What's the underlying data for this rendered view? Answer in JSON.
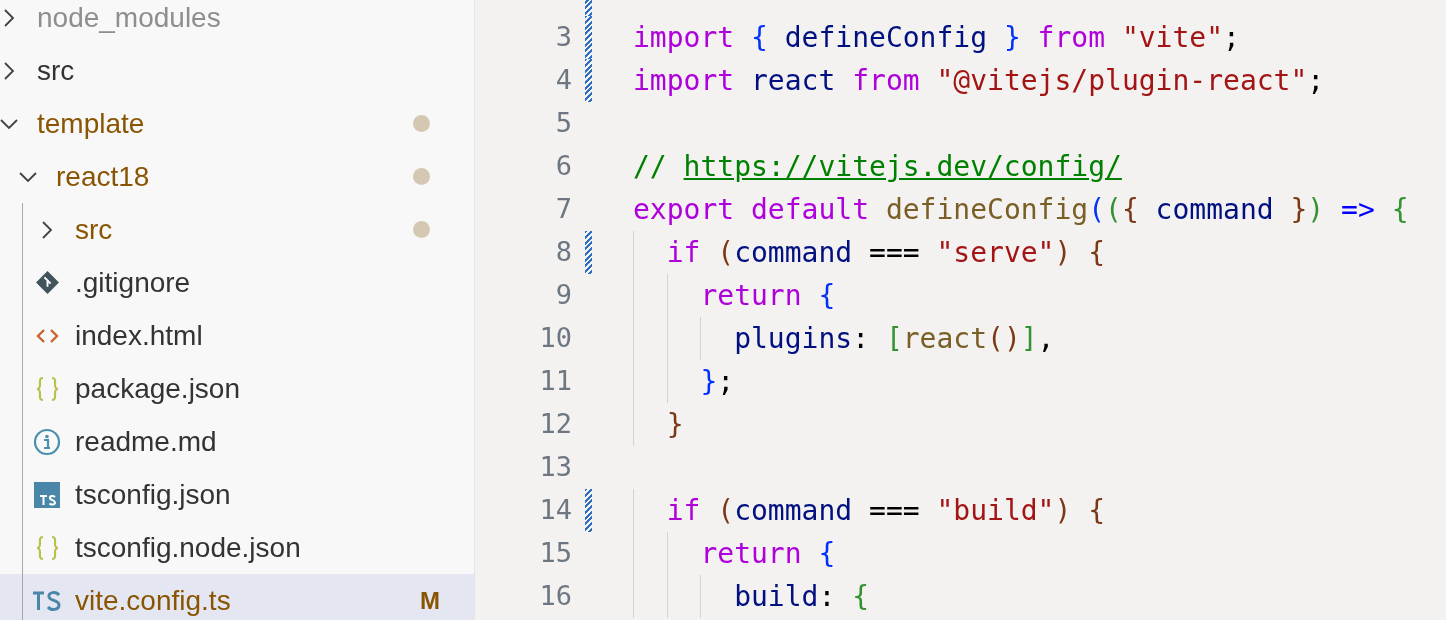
{
  "explorer": {
    "items": [
      {
        "name": "node_modules",
        "kind": "folder",
        "expanded": false,
        "ignored": true,
        "modified": false,
        "selected": false
      },
      {
        "name": "src",
        "kind": "folder",
        "expanded": false,
        "ignored": false,
        "modified": false,
        "selected": false
      },
      {
        "name": "template",
        "kind": "folder",
        "expanded": true,
        "ignored": false,
        "modified": true,
        "selected": false,
        "children": [
          {
            "name": "react18",
            "kind": "folder",
            "expanded": true,
            "ignored": false,
            "modified": true,
            "selected": false,
            "children": [
              {
                "name": "src",
                "kind": "folder",
                "expanded": false,
                "ignored": false,
                "modified": true,
                "selected": false
              },
              {
                "name": ".gitignore",
                "kind": "git",
                "ignored": false,
                "modified": false,
                "selected": false
              },
              {
                "name": "index.html",
                "kind": "html",
                "ignored": false,
                "modified": false,
                "selected": false
              },
              {
                "name": "package.json",
                "kind": "json",
                "ignored": false,
                "modified": false,
                "selected": false
              },
              {
                "name": "readme.md",
                "kind": "info",
                "ignored": false,
                "modified": false,
                "selected": false
              },
              {
                "name": "tsconfig.json",
                "kind": "tsbox",
                "ignored": false,
                "modified": false,
                "selected": false
              },
              {
                "name": "tsconfig.node.json",
                "kind": "json",
                "ignored": false,
                "modified": false,
                "selected": false
              },
              {
                "name": "vite.config.ts",
                "kind": "ts",
                "ignored": false,
                "modified": true,
                "selected": true,
                "badge": "M"
              }
            ]
          }
        ]
      }
    ]
  },
  "editor": {
    "lines": [
      {
        "modified": true
      },
      {
        "number": "3",
        "modified": true,
        "tokens": [
          {
            "kind": "kw",
            "text": "import "
          },
          {
            "kind": "b1",
            "text": "{"
          },
          {
            "kind": "var",
            "text": " defineConfig "
          },
          {
            "kind": "b1",
            "text": "}"
          },
          {
            "kind": "kw",
            "text": " from "
          },
          {
            "kind": "str",
            "text": "\"vite\""
          },
          {
            "kind": "punct",
            "text": ";"
          }
        ]
      },
      {
        "number": "4",
        "modified": true,
        "tokens": [
          {
            "kind": "kw",
            "text": "import "
          },
          {
            "kind": "var",
            "text": "react "
          },
          {
            "kind": "kw",
            "text": "from "
          },
          {
            "kind": "str",
            "text": "\"@vitejs/plugin-react\""
          },
          {
            "kind": "punct",
            "text": ";"
          }
        ]
      },
      {
        "number": "5",
        "modified": false
      },
      {
        "number": "6",
        "modified": false,
        "tokens": [
          {
            "kind": "comment",
            "text": "// "
          },
          {
            "kind": "link",
            "text": "https://vitejs.dev/config/"
          }
        ]
      },
      {
        "number": "7",
        "modified": false,
        "tokens": [
          {
            "kind": "kw",
            "text": "export default "
          },
          {
            "kind": "fn",
            "text": "defineConfig"
          },
          {
            "kind": "b1",
            "text": "("
          },
          {
            "kind": "b2",
            "text": "("
          },
          {
            "kind": "b3",
            "text": "{"
          },
          {
            "kind": "var",
            "text": " command "
          },
          {
            "kind": "b3",
            "text": "}"
          },
          {
            "kind": "b2",
            "text": ")"
          },
          {
            "kind": "arrow",
            "text": " => "
          },
          {
            "kind": "b2",
            "text": "{"
          }
        ]
      },
      {
        "number": "8",
        "modified": true,
        "tokens": [
          {
            "kind": "kw",
            "text": "  if "
          },
          {
            "kind": "b3",
            "text": "("
          },
          {
            "kind": "var",
            "text": "command"
          },
          {
            "kind": "punct",
            "text": " === "
          },
          {
            "kind": "str",
            "text": "\"serve\""
          },
          {
            "kind": "b3",
            "text": ") {"
          }
        ]
      },
      {
        "number": "9",
        "modified": false,
        "tokens": [
          {
            "kind": "kw",
            "text": "    return "
          },
          {
            "kind": "b1",
            "text": "{"
          }
        ]
      },
      {
        "number": "10",
        "modified": false,
        "tokens": [
          {
            "kind": "var",
            "text": "      plugins"
          },
          {
            "kind": "punct",
            "text": ": "
          },
          {
            "kind": "b2",
            "text": "["
          },
          {
            "kind": "fn",
            "text": "react"
          },
          {
            "kind": "b3",
            "text": "()"
          },
          {
            "kind": "b2",
            "text": "]"
          },
          {
            "kind": "punct",
            "text": ","
          }
        ]
      },
      {
        "number": "11",
        "modified": false,
        "tokens": [
          {
            "kind": "b1",
            "text": "    }"
          },
          {
            "kind": "punct",
            "text": ";"
          }
        ]
      },
      {
        "number": "12",
        "modified": false,
        "tokens": [
          {
            "kind": "b3",
            "text": "  }"
          }
        ]
      },
      {
        "number": "13",
        "modified": false
      },
      {
        "number": "14",
        "modified": true,
        "tokens": [
          {
            "kind": "kw",
            "text": "  if "
          },
          {
            "kind": "b3",
            "text": "("
          },
          {
            "kind": "var",
            "text": "command"
          },
          {
            "kind": "punct",
            "text": " === "
          },
          {
            "kind": "str",
            "text": "\"build\""
          },
          {
            "kind": "b3",
            "text": ") {"
          }
        ]
      },
      {
        "number": "15",
        "modified": false,
        "tokens": [
          {
            "kind": "kw",
            "text": "    return "
          },
          {
            "kind": "b1",
            "text": "{"
          }
        ]
      },
      {
        "number": "16",
        "modified": false,
        "tokens": [
          {
            "kind": "var",
            "text": "      build"
          },
          {
            "kind": "punct",
            "text": ": "
          },
          {
            "kind": "b2",
            "text": "{"
          }
        ]
      }
    ]
  }
}
